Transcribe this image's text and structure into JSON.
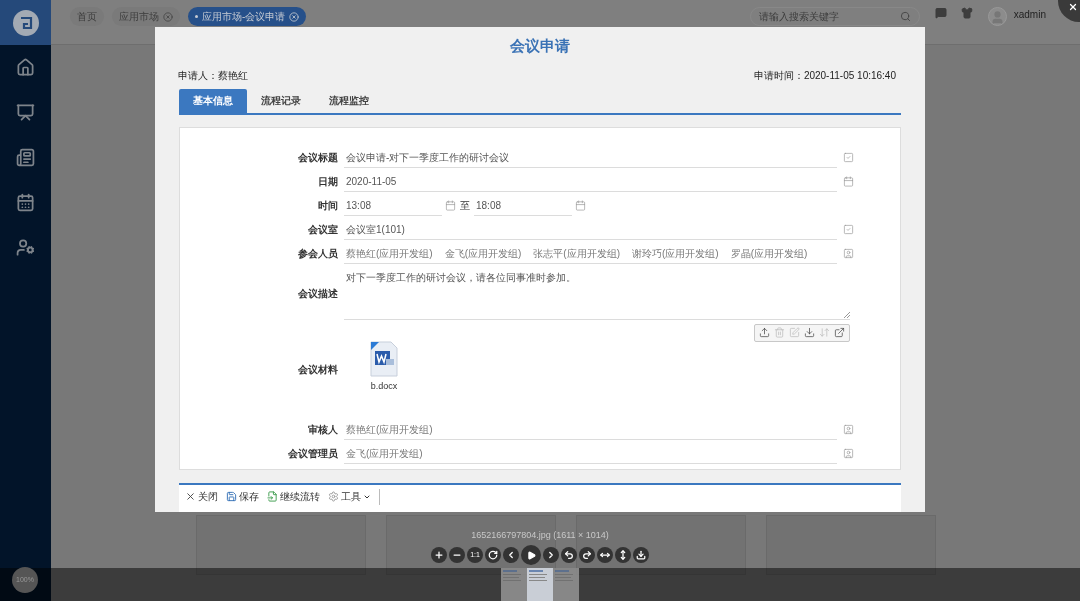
{
  "app": {
    "nav": [
      {
        "kind": "home",
        "selected": false
      },
      {
        "kind": "meeting",
        "selected": false
      },
      {
        "kind": "news",
        "selected": false
      },
      {
        "kind": "calendar",
        "selected": false
      },
      {
        "kind": "user-settings",
        "selected": false
      }
    ],
    "tabs": [
      {
        "label": "首页",
        "closable": false,
        "selected": false
      },
      {
        "label": "应用市场",
        "closable": true,
        "selected": false
      },
      {
        "label": "应用市场-会议申请",
        "closable": true,
        "selected": true
      }
    ],
    "search": {
      "placeholder": "请输入搜索关键字"
    },
    "user": "xadmin"
  },
  "viewer": {
    "caption": "1652166797804.jpg (1611 × 1014)",
    "zoom": "100%",
    "toolbar": [
      {
        "kind": "zoom-in"
      },
      {
        "kind": "zoom-out"
      },
      {
        "kind": "one-to-one",
        "label": "1:1"
      },
      {
        "kind": "reset"
      },
      {
        "kind": "prev"
      },
      {
        "kind": "play"
      },
      {
        "kind": "next"
      },
      {
        "kind": "rotate-left"
      },
      {
        "kind": "rotate-right"
      },
      {
        "kind": "flip-h"
      },
      {
        "kind": "flip-v"
      },
      {
        "kind": "download"
      }
    ],
    "thumbnails": [
      {
        "selected": false
      },
      {
        "selected": true
      },
      {
        "selected": false
      }
    ]
  },
  "document": {
    "title": "会议申请",
    "applicant": "申请人：蔡艳红",
    "time": "申请时间：2020-11-05 10:16:40",
    "tabs": [
      {
        "label": "基本信息",
        "selected": true
      },
      {
        "label": "流程记录",
        "selected": false
      },
      {
        "label": "流程监控",
        "selected": false
      }
    ],
    "fields": [
      {
        "kind": "select",
        "label": "会议标题",
        "value": "会议申请-对下一季度工作的研讨会议"
      },
      {
        "kind": "date",
        "label": "日期",
        "value": "2020-11-05"
      },
      {
        "kind": "time-range",
        "label": "时间",
        "start": "13:08",
        "separator": "至",
        "end": "18:08"
      },
      {
        "kind": "select",
        "label": "会议室",
        "value": "会议室1(101)"
      },
      {
        "kind": "people",
        "label": "参会人员",
        "values": [
          "蔡艳红(应用开发组)",
          "金飞(应用开发组)",
          "张志平(应用开发组)",
          "谢玲巧(应用开发组)",
          "罗晶(应用开发组)"
        ]
      },
      {
        "kind": "textarea",
        "label": "会议描述",
        "value": "对下一季度工作的研讨会议，请各位同事准时参加。"
      },
      {
        "kind": "files",
        "label": "会议材料",
        "tools": [
          {
            "kind": "upload",
            "disabled": false
          },
          {
            "kind": "delete",
            "disabled": true
          },
          {
            "kind": "edit",
            "disabled": true
          },
          {
            "kind": "download",
            "disabled": false
          },
          {
            "kind": "sort",
            "disabled": true
          },
          {
            "kind": "open",
            "disabled": false
          }
        ],
        "files": [
          {
            "name": "b.docx"
          }
        ]
      },
      {
        "kind": "person",
        "label": "审核人",
        "value": "蔡艳红(应用开发组)"
      },
      {
        "kind": "person",
        "label": "会议管理员",
        "value": "金飞(应用开发组)"
      }
    ],
    "actions": [
      {
        "kind": "close",
        "label": "关闭"
      },
      {
        "kind": "save",
        "label": "保存"
      },
      {
        "kind": "forward",
        "label": "继续流转"
      },
      {
        "kind": "tools",
        "label": "工具"
      }
    ]
  }
}
